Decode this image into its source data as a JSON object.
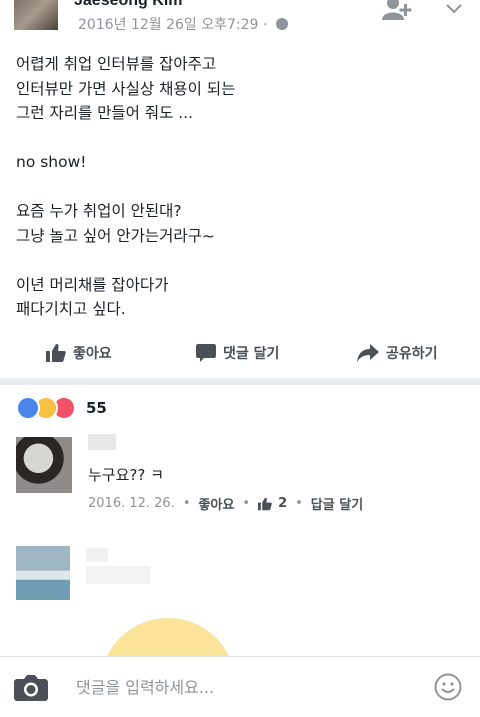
{
  "post": {
    "author": "Jaeseong Kim",
    "time": "2016년 12월 26일 오후7:29",
    "privacy_separator": "·",
    "lines": [
      "어렵게 취업 인터뷰를 잡아주고",
      "인터뷰만 가면 사실상 채용이 되는",
      "그런 자리를 만들어 줘도 ...",
      "",
      "no show!",
      "",
      "요즘 누가 취업이 안된대?",
      "그냥 놀고 싶어 안가는거라구~",
      "",
      "이년 머리채를 잡아다가",
      "패다기치고 싶다."
    ]
  },
  "actions": {
    "like_label": "좋아요",
    "comment_label": "댓글 달기",
    "share_label": "공유하기"
  },
  "reactions": {
    "count": "55",
    "icons": [
      "like-reaction",
      "haha-reaction",
      "love-reaction"
    ]
  },
  "comments": [
    {
      "text": "누구요?? ㅋ",
      "date": "2016. 12. 26.",
      "like_label": "좋아요",
      "like_count": "2",
      "reply_label": "답글 달기"
    }
  ],
  "composer": {
    "placeholder": "댓글을 입력하세요..."
  },
  "colors": {
    "text": "#1d2129",
    "secondary": "#90949c",
    "action": "#4b4f56",
    "like_blue": "#4a86ea",
    "haha_yellow": "#f6c244",
    "love_red": "#f25268",
    "divider": "#e9ebee"
  }
}
